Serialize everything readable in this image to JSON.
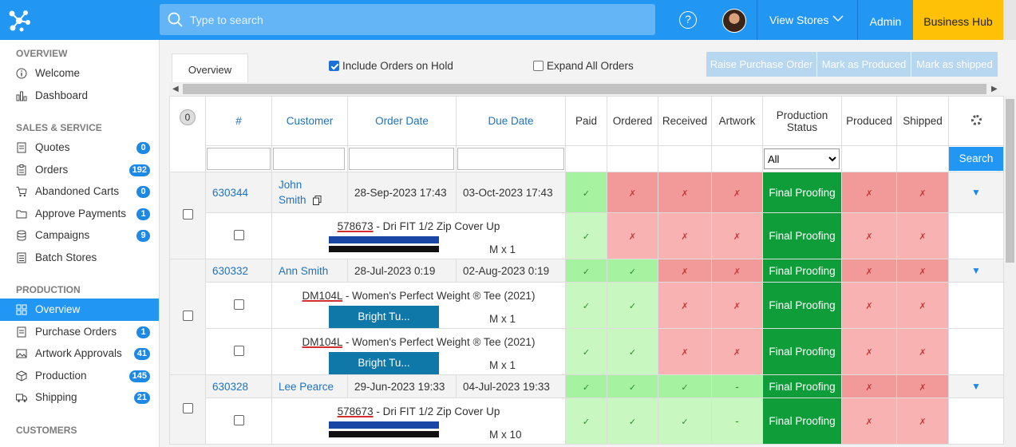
{
  "topbar": {
    "search_placeholder": "Type to search",
    "help": "?",
    "view_stores": "View Stores",
    "admin": "Admin",
    "business_hub": "Business Hub"
  },
  "sidebar": {
    "sections": [
      {
        "title": "OVERVIEW",
        "items": [
          {
            "label": "Welcome",
            "icon": "info-icon"
          },
          {
            "label": "Dashboard",
            "icon": "bar-chart-icon"
          }
        ]
      },
      {
        "title": "SALES & SERVICE",
        "items": [
          {
            "label": "Quotes",
            "icon": "document-icon",
            "badge": "0"
          },
          {
            "label": "Orders",
            "icon": "clipboard-icon",
            "badge": "192"
          },
          {
            "label": "Abandoned Carts",
            "icon": "cart-icon",
            "badge": "0"
          },
          {
            "label": "Approve Payments",
            "icon": "folder-icon",
            "badge": "1"
          },
          {
            "label": "Campaigns",
            "icon": "stack-icon",
            "badge": "9"
          },
          {
            "label": "Batch Stores",
            "icon": "list-icon"
          }
        ]
      },
      {
        "title": "PRODUCTION",
        "items": [
          {
            "label": "Overview",
            "icon": "grid-icon",
            "active": true
          },
          {
            "label": "Purchase Orders",
            "icon": "document-icon",
            "badge": "1"
          },
          {
            "label": "Artwork Approvals",
            "icon": "image-icon",
            "badge": "41"
          },
          {
            "label": "Production",
            "icon": "box-icon",
            "badge": "145"
          },
          {
            "label": "Shipping",
            "icon": "truck-icon",
            "badge": "21"
          }
        ]
      },
      {
        "title": "CUSTOMERS",
        "items": []
      }
    ]
  },
  "main": {
    "tab": "Overview",
    "include_on_hold": "Include Orders on Hold",
    "expand_all": "Expand All Orders",
    "buttons": [
      "Raise Purchase Order",
      "Mark as Produced",
      "Mark as shipped"
    ],
    "selected_count": "0",
    "columns": [
      "#",
      "Customer",
      "Order Date",
      "Due Date",
      "Paid",
      "Ordered",
      "Received",
      "Artwork",
      "Production Status",
      "Produced",
      "Shipped"
    ],
    "status_filter": "All",
    "search_btn": "Search",
    "orders": [
      {
        "id": "630344",
        "customer": "John Smith",
        "order_date": "28-Sep-2023 17:43",
        "due_date": "03-Oct-2023 17:43",
        "status": "Final Proofing",
        "items": [
          {
            "sku": "578673",
            "name": " - Dri FIT 1/2 Zip Cover Up",
            "qty": "M x 1"
          }
        ]
      },
      {
        "id": "630332",
        "customer": "Ann Smith",
        "order_date": "28-Jul-2023 0:19",
        "due_date": "02-Aug-2023 0:19",
        "status": "Final Proofing",
        "items": [
          {
            "sku": "DM104L",
            "name": " - Women's Perfect Weight ® Tee (2021)",
            "color": "Bright Tu...",
            "qty": "M x 1"
          },
          {
            "sku": "DM104L",
            "name": " - Women's Perfect Weight ® Tee (2021)",
            "color": "Bright Tu...",
            "qty": "M x 1"
          }
        ]
      },
      {
        "id": "630328",
        "customer": "Lee Pearce",
        "order_date": "29-Jun-2023 19:33",
        "due_date": "04-Jul-2023 19:33",
        "status": "Final Proofing",
        "artwork": "-",
        "items": [
          {
            "sku": "578673",
            "name": " - Dri FIT 1/2 Zip Cover Up",
            "qty": "M x 10"
          }
        ]
      }
    ]
  }
}
